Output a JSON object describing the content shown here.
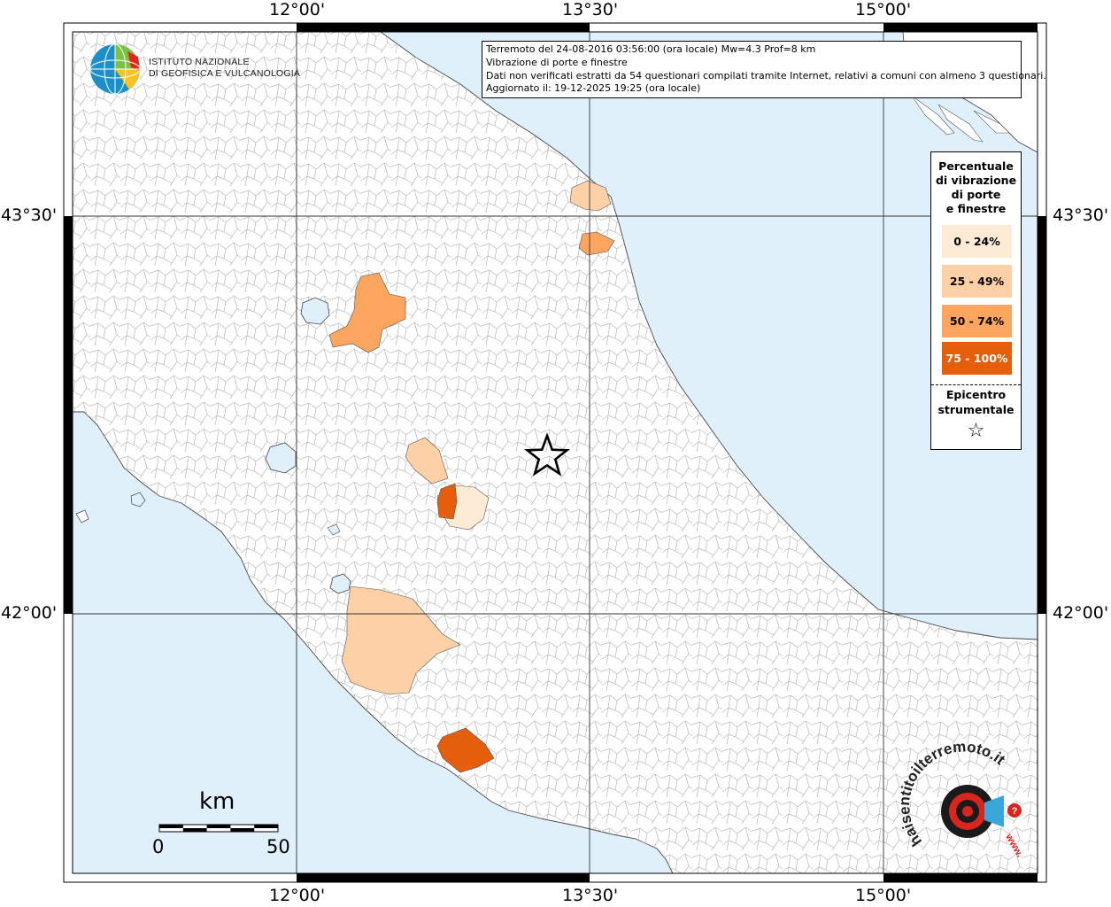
{
  "info": {
    "line1": "Terremoto del 24-08-2016 03:56:00 (ora locale) Mw=4.3 Prof=8 km",
    "line2": "Vibrazione di porte e finestre",
    "line3": "Dati non verificati estratti da 54 questionari compilati tramite Internet, relativi a comuni con almeno 3 questionari.",
    "line4": "Aggiornato il: 19-12-2025 19:25 (ora locale)"
  },
  "logos": {
    "ingv_line1": "ISTITUTO NAZIONALE",
    "ingv_line2": "DI GEOFISICA E VULCANOLOGIA",
    "hst_text": "haisentitoilterremoto.it",
    "hst_url": "www."
  },
  "axes": {
    "top": [
      "12°00'",
      "13°30'",
      "15°00'"
    ],
    "bottom": [
      "12°00'",
      "13°30'",
      "15°00'"
    ],
    "left": [
      "43°30'",
      "42°00'"
    ],
    "right": [
      "43°30'",
      "42°00'"
    ]
  },
  "legend": {
    "title_lines": [
      "Percentuale",
      "di vibrazione",
      "di porte",
      "e finestre"
    ],
    "classes": [
      {
        "label": "0 - 24%",
        "color": "#fdebd6",
        "text_color": "#000000"
      },
      {
        "label": "25 - 49%",
        "color": "#fdd0a5",
        "text_color": "#000000"
      },
      {
        "label": "50 - 74%",
        "color": "#fca55e",
        "text_color": "#000000"
      },
      {
        "label": "75 - 100%",
        "color": "#e55e0b",
        "text_color": "#ffffff"
      }
    ],
    "epicenter_lines": [
      "Epicentro",
      "strumentale"
    ],
    "epicenter_symbol": "☆"
  },
  "scale_bar": {
    "unit": "km",
    "min_label": "0",
    "max_label": "50"
  },
  "colors": {
    "sea": "#e0f0fb",
    "land": "#ffffff",
    "border": "#b5b5b5"
  }
}
